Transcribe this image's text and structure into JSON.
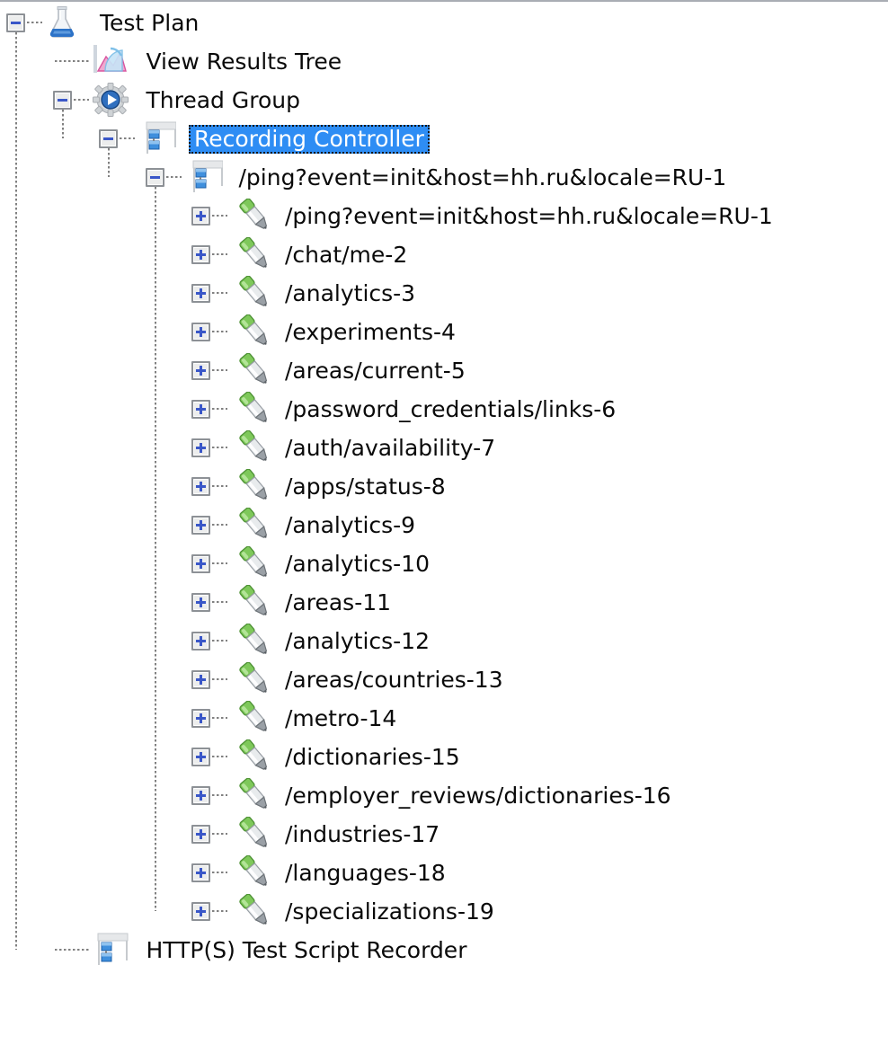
{
  "app": {
    "name": "Apache JMeter",
    "panel": "test-plan-tree"
  },
  "theme": {
    "background": "#ffffff",
    "text": "#0a0a0a",
    "selection_bg": "#2e8df4",
    "selection_text": "#ffffff",
    "selection_focus_border": "#141414",
    "toggle_glyph": "#3a57c8",
    "toggle_border": "#8d9196",
    "connector_line": "#808080",
    "panel_border": "#a9adb4"
  },
  "tree": {
    "nodes": [
      {
        "id": "test-plan",
        "label": "Test Plan",
        "icon": "test-plan-flask-icon",
        "depth": 0,
        "toggle": "minus",
        "selected": false
      },
      {
        "id": "view-results-tree",
        "label": "View Results Tree",
        "icon": "view-results-tree-chart-icon",
        "depth": 1,
        "toggle": "none",
        "selected": false
      },
      {
        "id": "thread-group",
        "label": "Thread Group",
        "icon": "thread-group-gear-icon",
        "depth": 1,
        "toggle": "minus",
        "selected": false
      },
      {
        "id": "recording-controller",
        "label": "Recording Controller",
        "icon": "controller-icon",
        "depth": 2,
        "toggle": "minus",
        "selected": true
      },
      {
        "id": "transaction-ping-1",
        "label": "/ping?event=init&host=hh.ru&locale=RU-1",
        "icon": "controller-icon",
        "depth": 3,
        "toggle": "minus",
        "selected": false
      },
      {
        "id": "sampler-1",
        "label": "/ping?event=init&host=hh.ru&locale=RU-1",
        "icon": "http-sampler-pipette-icon",
        "depth": 4,
        "toggle": "plus",
        "selected": false
      },
      {
        "id": "sampler-2",
        "label": "/chat/me-2",
        "icon": "http-sampler-pipette-icon",
        "depth": 4,
        "toggle": "plus",
        "selected": false
      },
      {
        "id": "sampler-3",
        "label": "/analytics-3",
        "icon": "http-sampler-pipette-icon",
        "depth": 4,
        "toggle": "plus",
        "selected": false
      },
      {
        "id": "sampler-4",
        "label": "/experiments-4",
        "icon": "http-sampler-pipette-icon",
        "depth": 4,
        "toggle": "plus",
        "selected": false
      },
      {
        "id": "sampler-5",
        "label": "/areas/current-5",
        "icon": "http-sampler-pipette-icon",
        "depth": 4,
        "toggle": "plus",
        "selected": false
      },
      {
        "id": "sampler-6",
        "label": "/password_credentials/links-6",
        "icon": "http-sampler-pipette-icon",
        "depth": 4,
        "toggle": "plus",
        "selected": false
      },
      {
        "id": "sampler-7",
        "label": "/auth/availability-7",
        "icon": "http-sampler-pipette-icon",
        "depth": 4,
        "toggle": "plus",
        "selected": false
      },
      {
        "id": "sampler-8",
        "label": "/apps/status-8",
        "icon": "http-sampler-pipette-icon",
        "depth": 4,
        "toggle": "plus",
        "selected": false
      },
      {
        "id": "sampler-9",
        "label": "/analytics-9",
        "icon": "http-sampler-pipette-icon",
        "depth": 4,
        "toggle": "plus",
        "selected": false
      },
      {
        "id": "sampler-10",
        "label": "/analytics-10",
        "icon": "http-sampler-pipette-icon",
        "depth": 4,
        "toggle": "plus",
        "selected": false
      },
      {
        "id": "sampler-11",
        "label": "/areas-11",
        "icon": "http-sampler-pipette-icon",
        "depth": 4,
        "toggle": "plus",
        "selected": false
      },
      {
        "id": "sampler-12",
        "label": "/analytics-12",
        "icon": "http-sampler-pipette-icon",
        "depth": 4,
        "toggle": "plus",
        "selected": false
      },
      {
        "id": "sampler-13",
        "label": "/areas/countries-13",
        "icon": "http-sampler-pipette-icon",
        "depth": 4,
        "toggle": "plus",
        "selected": false
      },
      {
        "id": "sampler-14",
        "label": "/metro-14",
        "icon": "http-sampler-pipette-icon",
        "depth": 4,
        "toggle": "plus",
        "selected": false
      },
      {
        "id": "sampler-15",
        "label": "/dictionaries-15",
        "icon": "http-sampler-pipette-icon",
        "depth": 4,
        "toggle": "plus",
        "selected": false
      },
      {
        "id": "sampler-16",
        "label": "/employer_reviews/dictionaries-16",
        "icon": "http-sampler-pipette-icon",
        "depth": 4,
        "toggle": "plus",
        "selected": false
      },
      {
        "id": "sampler-17",
        "label": "/industries-17",
        "icon": "http-sampler-pipette-icon",
        "depth": 4,
        "toggle": "plus",
        "selected": false
      },
      {
        "id": "sampler-18",
        "label": "/languages-18",
        "icon": "http-sampler-pipette-icon",
        "depth": 4,
        "toggle": "plus",
        "selected": false
      },
      {
        "id": "sampler-19",
        "label": "/specializations-19",
        "icon": "http-sampler-pipette-icon",
        "depth": 4,
        "toggle": "plus",
        "selected": false
      },
      {
        "id": "http-test-script-recorder",
        "label": "HTTP(S) Test Script Recorder",
        "icon": "recorder-icon",
        "depth": 1,
        "toggle": "none",
        "selected": false
      }
    ]
  }
}
